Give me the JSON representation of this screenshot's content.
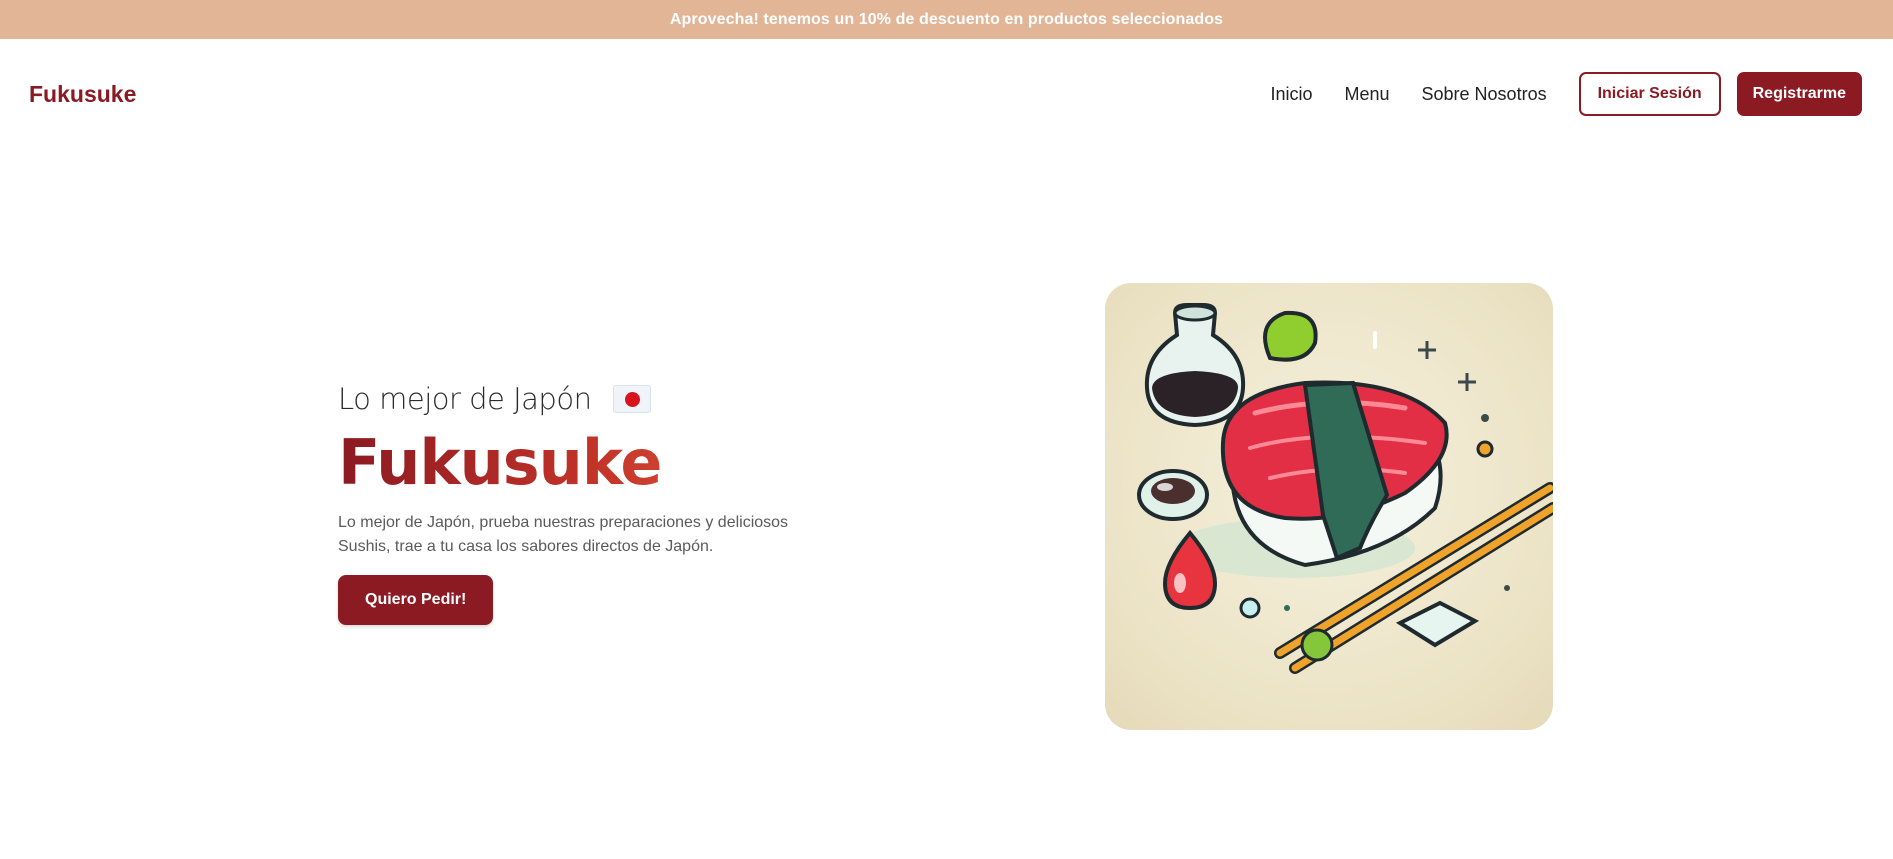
{
  "promo": {
    "text": "Aprovecha! tenemos un 10% de descuento en productos seleccionados",
    "color": "#e1b596"
  },
  "nav": {
    "brand": "Fukusuke",
    "links": [
      "Inicio",
      "Menu",
      "Sobre Nosotros"
    ],
    "login_label": "Iniciar Sesión",
    "register_label": "Registrarme"
  },
  "hero": {
    "subtitle": "Lo mejor de Japón",
    "flag_icon": "japan-flag-icon",
    "title": "Fukusuke",
    "description": "Lo mejor de Japón, prueba nuestras preparaciones y deliciosos Sushis, trae a tu casa los sabores directos de Japón.",
    "cta_label": "Quiero Pedir!",
    "image_icon": "sushi-illustration"
  },
  "colors": {
    "brand": "#8b1a22",
    "accent_gradient_end": "#e45a3b"
  }
}
